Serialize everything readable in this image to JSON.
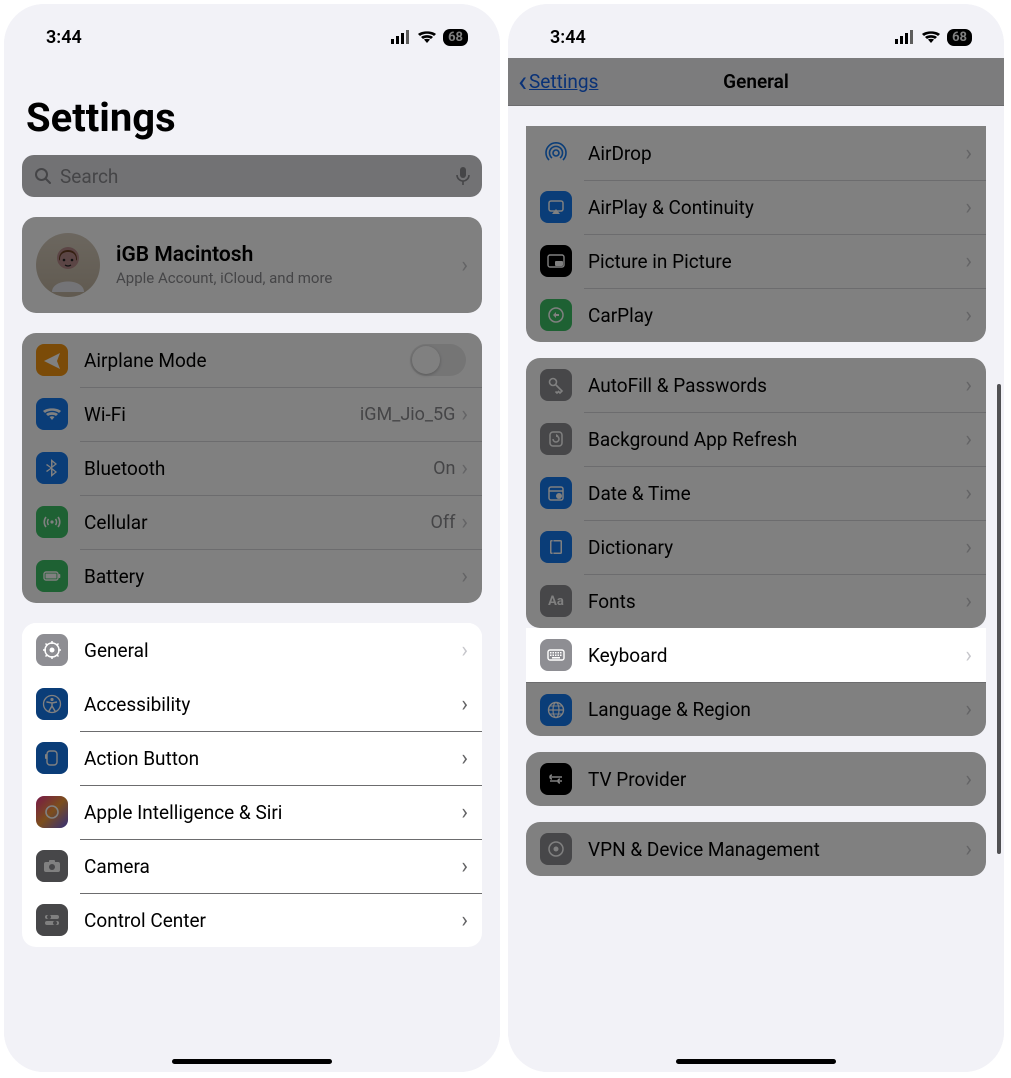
{
  "status": {
    "time": "3:44",
    "battery": "68"
  },
  "left": {
    "title": "Settings",
    "search_placeholder": "Search",
    "profile": {
      "name": "iGB Macintosh",
      "sub": "Apple Account, iCloud, and more"
    },
    "rows1": {
      "airplane": "Airplane Mode",
      "wifi": "Wi-Fi",
      "wifi_val": "iGM_Jio_5G",
      "bluetooth": "Bluetooth",
      "bluetooth_val": "On",
      "cellular": "Cellular",
      "cellular_val": "Off",
      "battery": "Battery"
    },
    "rows2": {
      "general": "General",
      "accessibility": "Accessibility",
      "action": "Action Button",
      "siri": "Apple Intelligence & Siri",
      "camera": "Camera",
      "cc": "Control Center"
    }
  },
  "right": {
    "back": "Settings",
    "title": "General",
    "g1": {
      "airdrop": "AirDrop",
      "airplay": "AirPlay & Continuity",
      "pip": "Picture in Picture",
      "carplay": "CarPlay"
    },
    "g2": {
      "autofill": "AutoFill & Passwords",
      "bgrefresh": "Background App Refresh",
      "dt": "Date & Time",
      "dict": "Dictionary",
      "fonts": "Fonts",
      "keyboard": "Keyboard",
      "lang": "Language & Region"
    },
    "g3": {
      "tv": "TV Provider"
    },
    "g4": {
      "vpn": "VPN & Device Management"
    }
  }
}
